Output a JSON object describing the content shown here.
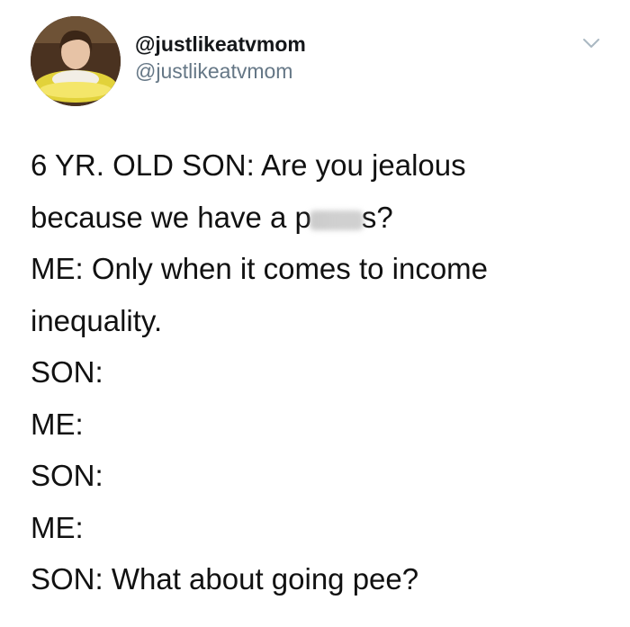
{
  "author": {
    "display_name": "@justlikeatvmom",
    "handle": "@justlikeatvmom"
  },
  "tweet": {
    "line1": "6 YR. OLD SON: Are you jealous",
    "line2_prefix": "because we have a p",
    "line2_suffix": "s?",
    "line3": "ME: Only when it comes to income",
    "line4": "inequality.",
    "line5": "SON:",
    "line6": "ME:",
    "line7": "SON:",
    "line8": "ME:",
    "line9": "SON: What about going pee?"
  },
  "icons": {
    "menu": "chevron-down-icon"
  },
  "colors": {
    "handle": "#657786",
    "text": "#111111"
  }
}
